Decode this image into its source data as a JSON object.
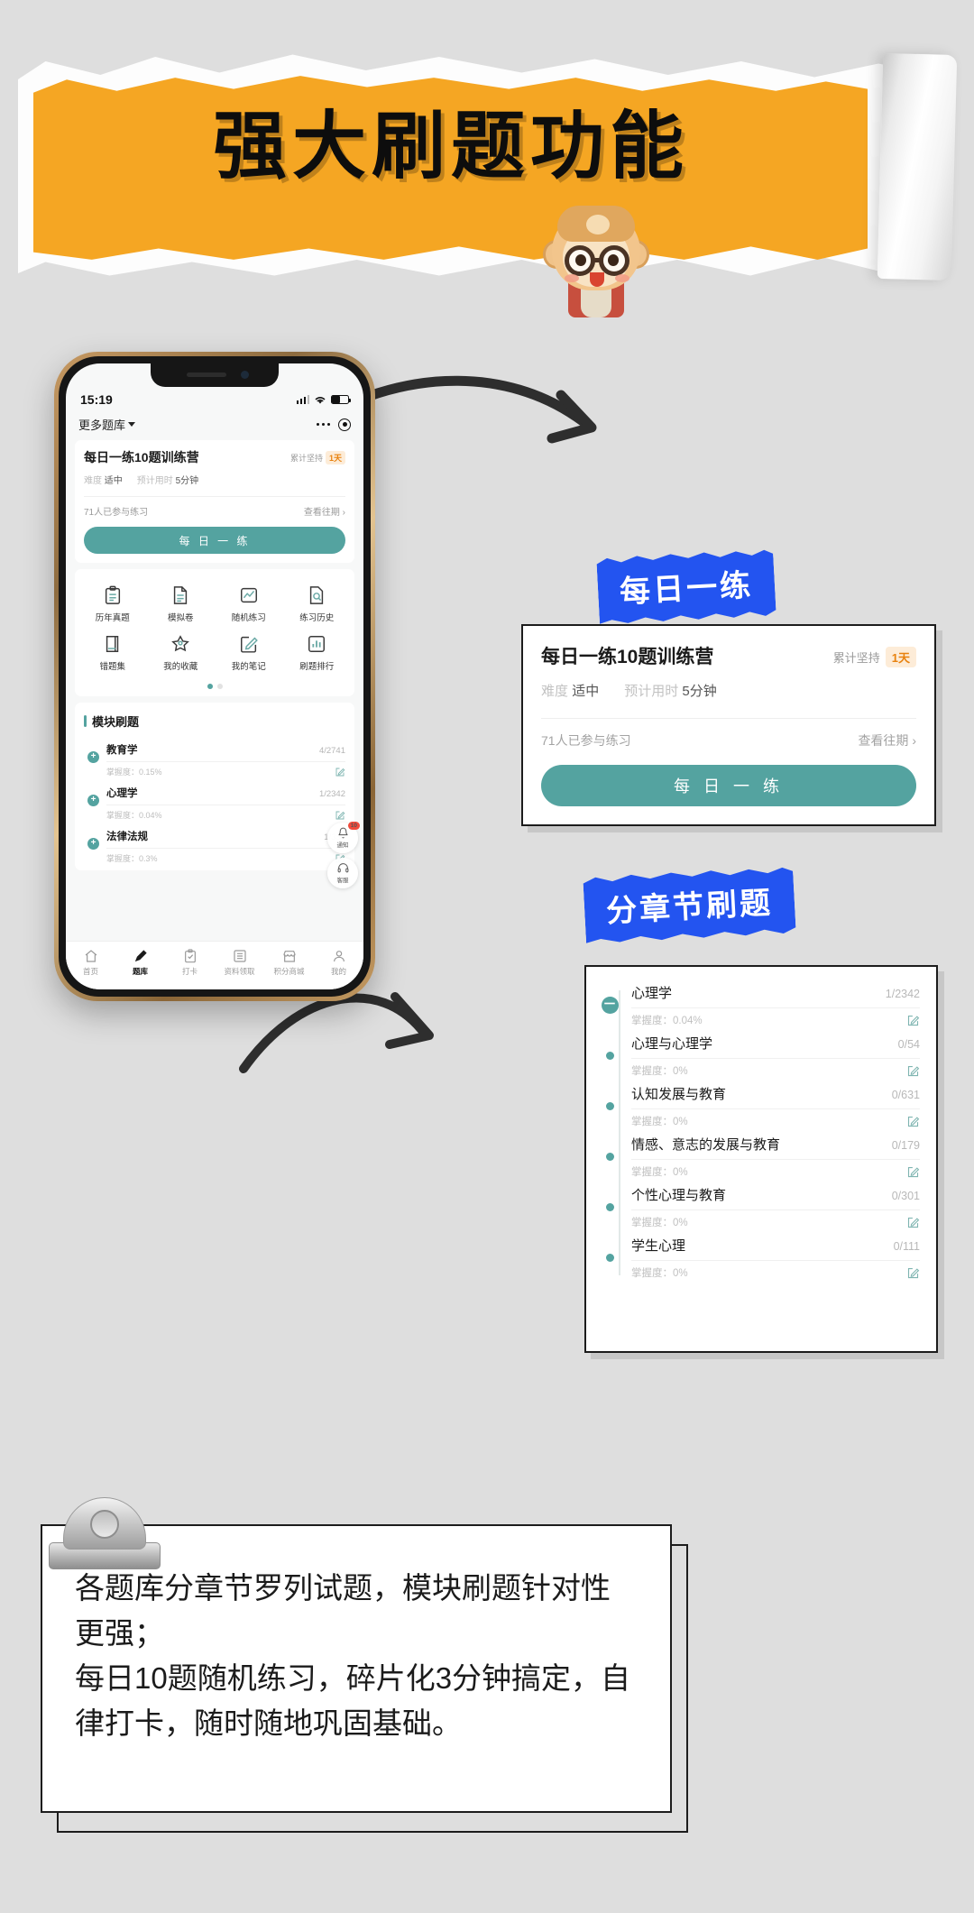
{
  "header": {
    "title": "强大刷题功能"
  },
  "phone": {
    "status": {
      "time": "15:19"
    },
    "nav": {
      "left_label": "更多题库"
    },
    "daily_card": {
      "title": "每日一练10题训练营",
      "streak_label": "累计坚持",
      "streak_value": "1天",
      "difficulty_label": "难度",
      "difficulty_value": "适中",
      "duration_label": "预计用时",
      "duration_value": "5分钟",
      "participants": "71人已参与练习",
      "history_link": "查看往期 ›",
      "button": "每 日 一 练"
    },
    "grid": [
      {
        "label": "历年真题",
        "icon": "clipboard-icon"
      },
      {
        "label": "模拟卷",
        "icon": "document-icon"
      },
      {
        "label": "随机练习",
        "icon": "chart-icon"
      },
      {
        "label": "练习历史",
        "icon": "search-doc-icon"
      },
      {
        "label": "错题集",
        "icon": "book-icon"
      },
      {
        "label": "我的收藏",
        "icon": "star-icon"
      },
      {
        "label": "我的笔记",
        "icon": "edit-square-icon"
      },
      {
        "label": "刷题排行",
        "icon": "ranking-icon"
      }
    ],
    "module": {
      "title": "模块刷题",
      "mastery_label": "掌握度：",
      "rows": [
        {
          "name": "教育学",
          "count": "4/2741",
          "mastery": "0.15%"
        },
        {
          "name": "心理学",
          "count": "1/2342",
          "mastery": "0.04%"
        },
        {
          "name": "法律法规",
          "count": "1/330",
          "mastery": "0.3%"
        }
      ]
    },
    "floats": [
      {
        "label": "通知",
        "badge": "10",
        "icon": "bell-icon"
      },
      {
        "label": "客服",
        "badge": "",
        "icon": "headset-icon"
      }
    ],
    "tabs": [
      {
        "label": "首页",
        "icon": "home-icon",
        "active": false
      },
      {
        "label": "题库",
        "icon": "pencil-icon",
        "active": true
      },
      {
        "label": "打卡",
        "icon": "checkin-icon",
        "active": false
      },
      {
        "label": "资料领取",
        "icon": "list-icon",
        "active": false
      },
      {
        "label": "积分商城",
        "icon": "shop-icon",
        "active": false
      },
      {
        "label": "我的",
        "icon": "user-icon",
        "active": false
      }
    ]
  },
  "callouts": {
    "label_daily": "每日一练",
    "label_chapter": "分章节刷题",
    "daily_card": {
      "title": "每日一练10题训练营",
      "streak_label": "累计坚持",
      "streak_value": "1天",
      "difficulty_label": "难度",
      "difficulty_value": "适中",
      "duration_label": "预计用时",
      "duration_value": "5分钟",
      "participants": "71人已参与练习",
      "history_link": "查看往期 ›",
      "button": "每 日 一 练"
    },
    "chapter_list": {
      "mastery_label": "掌握度：",
      "rows": [
        {
          "name": "心理学",
          "count": "1/2342",
          "mastery": "0.04%",
          "collapse": "－"
        },
        {
          "name": "心理与心理学",
          "count": "0/54",
          "mastery": "0%",
          "collapse": ""
        },
        {
          "name": "认知发展与教育",
          "count": "0/631",
          "mastery": "0%",
          "collapse": ""
        },
        {
          "name": "情感、意志的发展与教育",
          "count": "0/179",
          "mastery": "0%",
          "collapse": ""
        },
        {
          "name": "个性心理与教育",
          "count": "0/301",
          "mastery": "0%",
          "collapse": ""
        },
        {
          "name": "学生心理",
          "count": "0/111",
          "mastery": "0%",
          "collapse": ""
        }
      ]
    }
  },
  "footer": {
    "line1": "各题库分章节罗列试题，模块刷题针对性更强；",
    "line2": "每日10题随机练习，碎片化3分钟搞定，自律打卡，随时随地巩固基础。"
  },
  "colors": {
    "accent_orange": "#f5a623",
    "accent_blue": "#2354f0",
    "accent_teal": "#54a3a0",
    "badge_orange": "#e8820f",
    "background": "#dedede"
  }
}
